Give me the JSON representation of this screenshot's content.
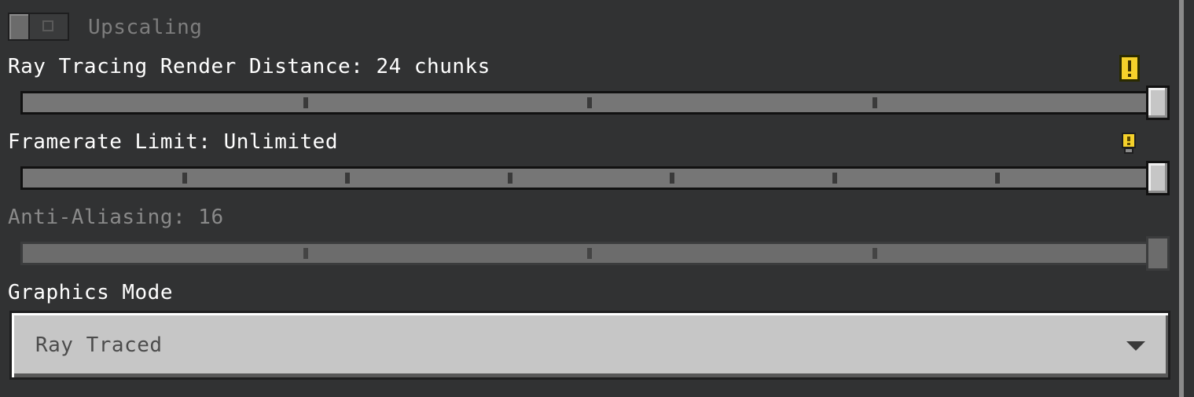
{
  "upscaling": {
    "label": "Upscaling",
    "enabled": false,
    "off_glyph": "O"
  },
  "ray_tracing_distance": {
    "label": "Ray Tracing Render Distance: 24 chunks",
    "warning_icon": "exclamation-warning-icon",
    "tick_count": 3,
    "value_fraction": 1.0
  },
  "framerate_limit": {
    "label": "Framerate Limit: Unlimited",
    "info_icon": "lightbulb-icon",
    "tick_count": 6,
    "value_fraction": 1.0
  },
  "anti_aliasing": {
    "label": "Anti-Aliasing: 16",
    "disabled": true,
    "tick_count": 3,
    "value_fraction": 1.0
  },
  "graphics_mode": {
    "label": "Graphics Mode",
    "selected": "Ray Traced"
  },
  "colors": {
    "background": "#313233",
    "warning_yellow": "#f5d12b",
    "dropdown_bg": "#c6c6c6"
  }
}
